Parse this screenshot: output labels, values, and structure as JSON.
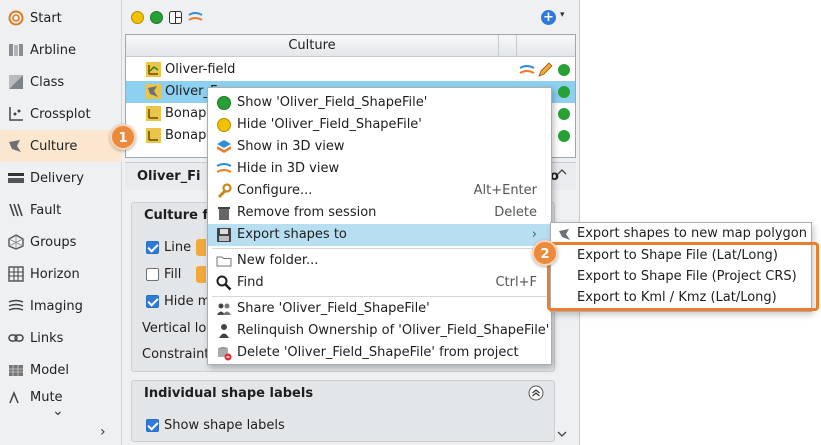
{
  "sidebar": {
    "items": [
      {
        "label": "Start",
        "icon": "target-icon"
      },
      {
        "label": "Arbline",
        "icon": "arbline-icon"
      },
      {
        "label": "Class",
        "icon": "class-icon"
      },
      {
        "label": "Crossplot",
        "icon": "crossplot-icon"
      },
      {
        "label": "Culture",
        "icon": "culture-icon"
      },
      {
        "label": "Delivery",
        "icon": "delivery-icon"
      },
      {
        "label": "Fault",
        "icon": "fault-icon"
      },
      {
        "label": "Groups",
        "icon": "groups-icon"
      },
      {
        "label": "Horizon",
        "icon": "horizon-icon"
      },
      {
        "label": "Imaging",
        "icon": "imaging-icon"
      },
      {
        "label": "Links",
        "icon": "links-icon"
      },
      {
        "label": "Model",
        "icon": "model-icon"
      },
      {
        "label": "Mute",
        "icon": "mute-icon"
      }
    ],
    "more_glyph": "⌄",
    "next_glyph": "›"
  },
  "toolbar": {
    "add_glyph": "+",
    "caret_glyph": "▾"
  },
  "table": {
    "header": "Culture",
    "rows": [
      {
        "name": "Oliver-field"
      },
      {
        "name": "Oliver_F"
      },
      {
        "name": "Bonapa"
      },
      {
        "name": "Bonapa"
      }
    ]
  },
  "panel": {
    "title": "Oliver_Fi",
    "title_suffix": "o",
    "group1": {
      "title": "Culture fi",
      "line_label": "Line",
      "fill_label": "Fill",
      "hide_label": "Hide m",
      "vertical_label": "Vertical loc",
      "constraint_label": "Constraint"
    },
    "group2": {
      "title": "Individual shape labels",
      "show_labels": "Show shape labels"
    }
  },
  "context_menu": {
    "items": [
      {
        "label": "Show 'Oliver_Field_ShapeFile'",
        "shortcut": "",
        "icon": "green-dot-icon"
      },
      {
        "label": "Hide 'Oliver_Field_ShapeFile'",
        "shortcut": "",
        "icon": "yellow-dot-icon"
      },
      {
        "label": "Show in 3D view",
        "shortcut": "",
        "icon": "3d-show-icon"
      },
      {
        "label": "Hide in 3D view",
        "shortcut": "",
        "icon": "3d-hide-icon"
      },
      {
        "label": "Configure...",
        "shortcut": "Alt+Enter",
        "icon": "wrench-icon"
      },
      {
        "label": "Remove from session",
        "shortcut": "Delete",
        "icon": "trash-icon"
      },
      {
        "label": "Export shapes to",
        "shortcut": "›",
        "icon": "save-icon"
      },
      {
        "label": "New folder...",
        "shortcut": "",
        "icon": "folder-icon"
      },
      {
        "label": "Find",
        "shortcut": "Ctrl+F",
        "icon": "magnifier-icon"
      },
      {
        "label": "Share 'Oliver_Field_ShapeFile'",
        "shortcut": "",
        "icon": "share-icon"
      },
      {
        "label": "Relinquish Ownership of 'Oliver_Field_ShapeFile'",
        "shortcut": "",
        "icon": "person-icon"
      },
      {
        "label": "Delete 'Oliver_Field_ShapeFile' from project",
        "shortcut": "",
        "icon": "delete-db-icon"
      }
    ]
  },
  "submenu": {
    "items": [
      {
        "label": "Export shapes to new map polygon"
      },
      {
        "label": "Export to Shape File (Lat/Long)"
      },
      {
        "label": "Export to Shape File (Project CRS)"
      },
      {
        "label": "Export to Kml / Kmz (Lat/Long)"
      }
    ]
  },
  "badges": {
    "one": "1",
    "two": "2"
  },
  "colors": {
    "accent": "#ee7d2a",
    "selection": "#8dd0ef",
    "menu_highlight": "#b8def2",
    "green": "#27a136",
    "yellow": "#f2c200"
  }
}
